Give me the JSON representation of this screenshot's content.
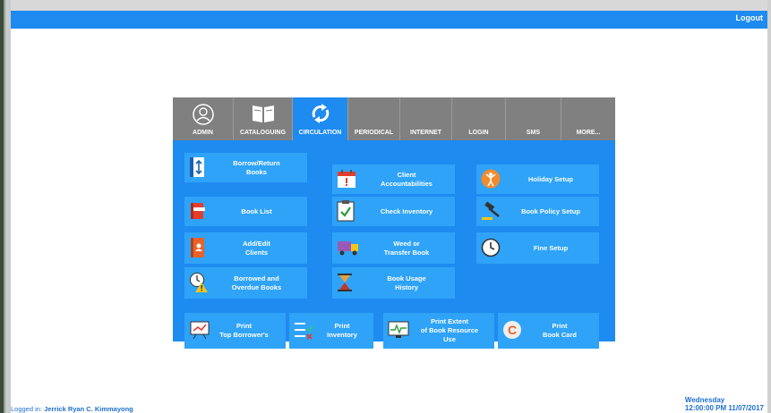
{
  "header": {
    "logout_label": "Logout"
  },
  "tabs": [
    {
      "label": "ADMIN",
      "icon": "admin-user-icon"
    },
    {
      "label": "CATALOGUING",
      "icon": "book-icon"
    },
    {
      "label": "CIRCULATION",
      "icon": "circulation-arrows-icon",
      "active": true
    },
    {
      "label": "PERIODICAL"
    },
    {
      "label": "INTERNET"
    },
    {
      "label": "LOGIN"
    },
    {
      "label": "SMS"
    },
    {
      "label": "MORE..."
    }
  ],
  "circulation": {
    "col1": [
      "Borrow/Return\nBooks",
      "Book List",
      "Add/Edit\nClients",
      "Borrowed and\nOverdue Books"
    ],
    "col2": [
      "Client\nAccountabilities",
      "Check Inventory",
      "Weed or\nTransfer Book",
      "Book Usage\nHistory"
    ],
    "col3": [
      "Holiday Setup",
      "Book Policy Setup",
      "Fine Setup"
    ],
    "bottom": [
      "Print\nTop Borrower's",
      "Print\nInventory",
      "Print Extent\nof Book Resource\nUse",
      "Print\nBook Card"
    ]
  },
  "footer": {
    "logged_in_label": "Logged in:",
    "user": "Jerrick Ryan C. Kimmayong",
    "day": "Wednesday",
    "datetime": "12:00:00 PM 11/07/2017"
  },
  "colors": {
    "accent": "#1e8bf0",
    "button": "#2fa3f7",
    "tabbar": "#808080"
  }
}
